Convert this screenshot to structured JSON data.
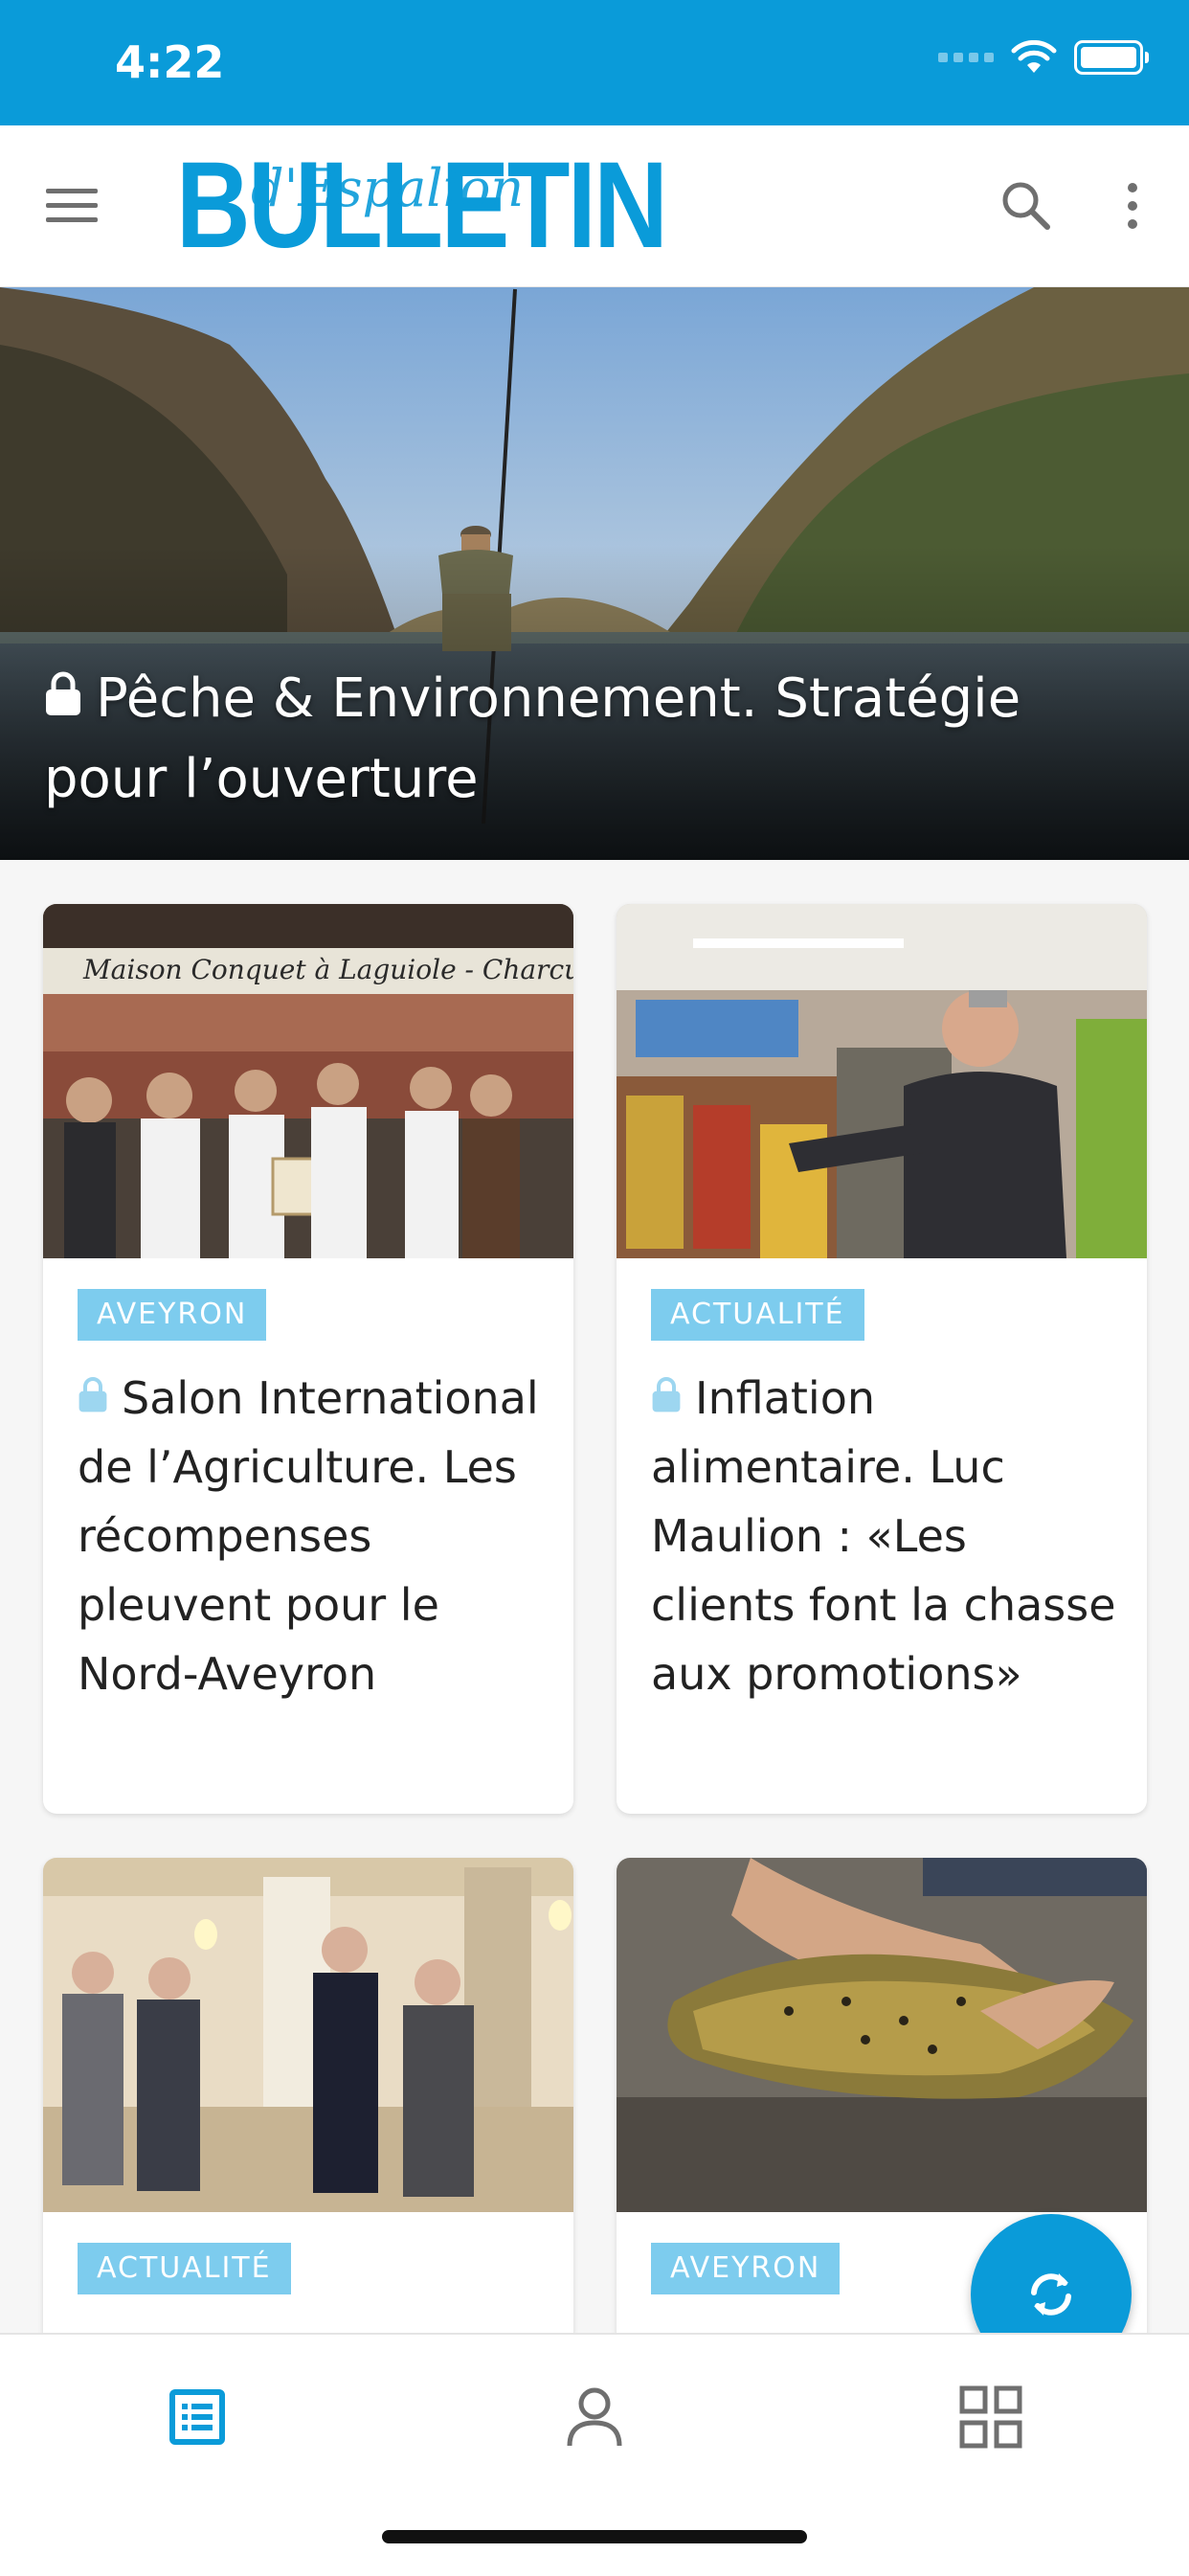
{
  "status_bar": {
    "time": "4:22"
  },
  "app_bar": {
    "logo_text": "BULLETIN",
    "logo_script": "d'Espalion"
  },
  "hero": {
    "title": "Pêche & Environnement. Stratégie pour l’ouverture",
    "locked": true
  },
  "cards": [
    {
      "category": "AVEYRON",
      "title": "Salon International de l’Agriculture. Les récompenses pleuvent pour le Nord-Aveyron",
      "locked": true,
      "image_caption": "Maison Conquet à Laguiole - Charcuterie"
    },
    {
      "category": "ACTUALITÉ",
      "title": "Inflation alimentaire. Luc Maulion : «Les clients font la chasse aux promotions»",
      "locked": true
    },
    {
      "category": "ACTUALITÉ",
      "title": "",
      "locked": true
    },
    {
      "category": "AVEYRON",
      "title": "",
      "locked": true
    }
  ],
  "bottom_nav": {
    "tabs": [
      "news-list",
      "account",
      "sections"
    ],
    "active": "news-list"
  },
  "colors": {
    "accent": "#0a9bd9",
    "badge": "#7dccee",
    "icon_gray": "#6f6f6f"
  }
}
